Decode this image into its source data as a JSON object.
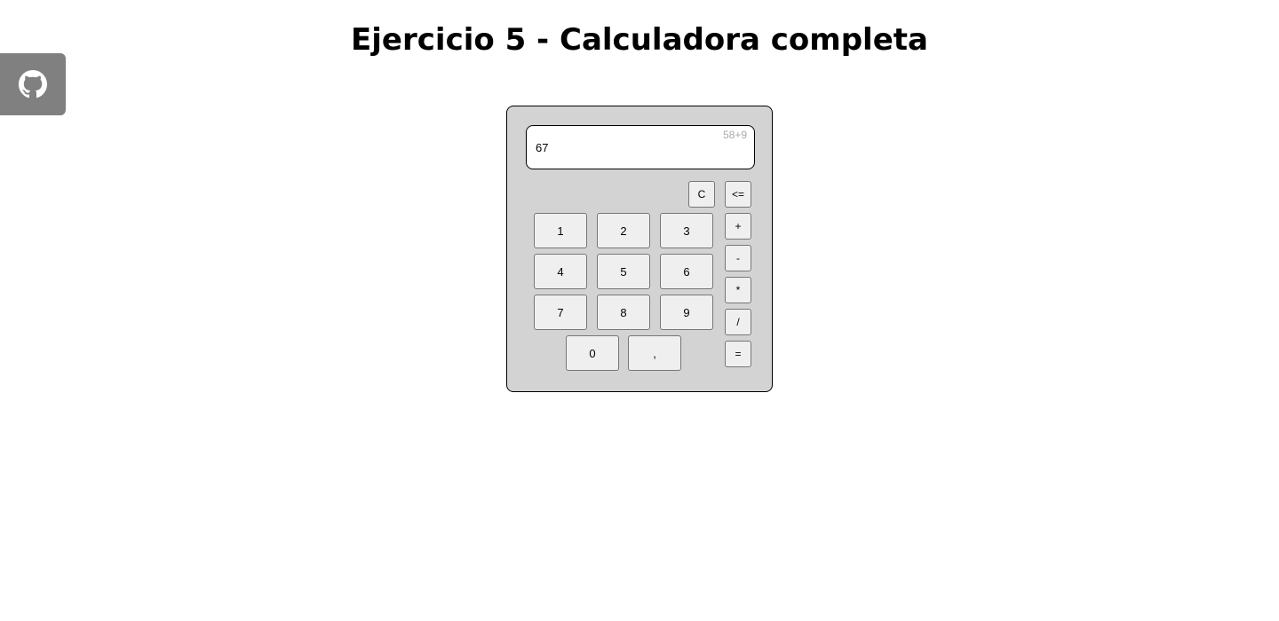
{
  "header": {
    "title": "Ejercicio 5 - Calculadora completa"
  },
  "github": {
    "icon": "github-icon"
  },
  "calculator": {
    "display": {
      "history": "58+9",
      "result": "67"
    },
    "keys": {
      "clear": "C",
      "backspace": "<=",
      "plus": "+",
      "minus": "-",
      "multiply": "*",
      "divide": "/",
      "equals": "=",
      "one": "1",
      "two": "2",
      "three": "3",
      "four": "4",
      "five": "5",
      "six": "6",
      "seven": "7",
      "eight": "8",
      "nine": "9",
      "zero": "0",
      "comma": ","
    }
  },
  "colors": {
    "calculator_bg": "#d3d3d3",
    "github_tab_bg": "#808080",
    "history_text": "#aaaaaa"
  }
}
